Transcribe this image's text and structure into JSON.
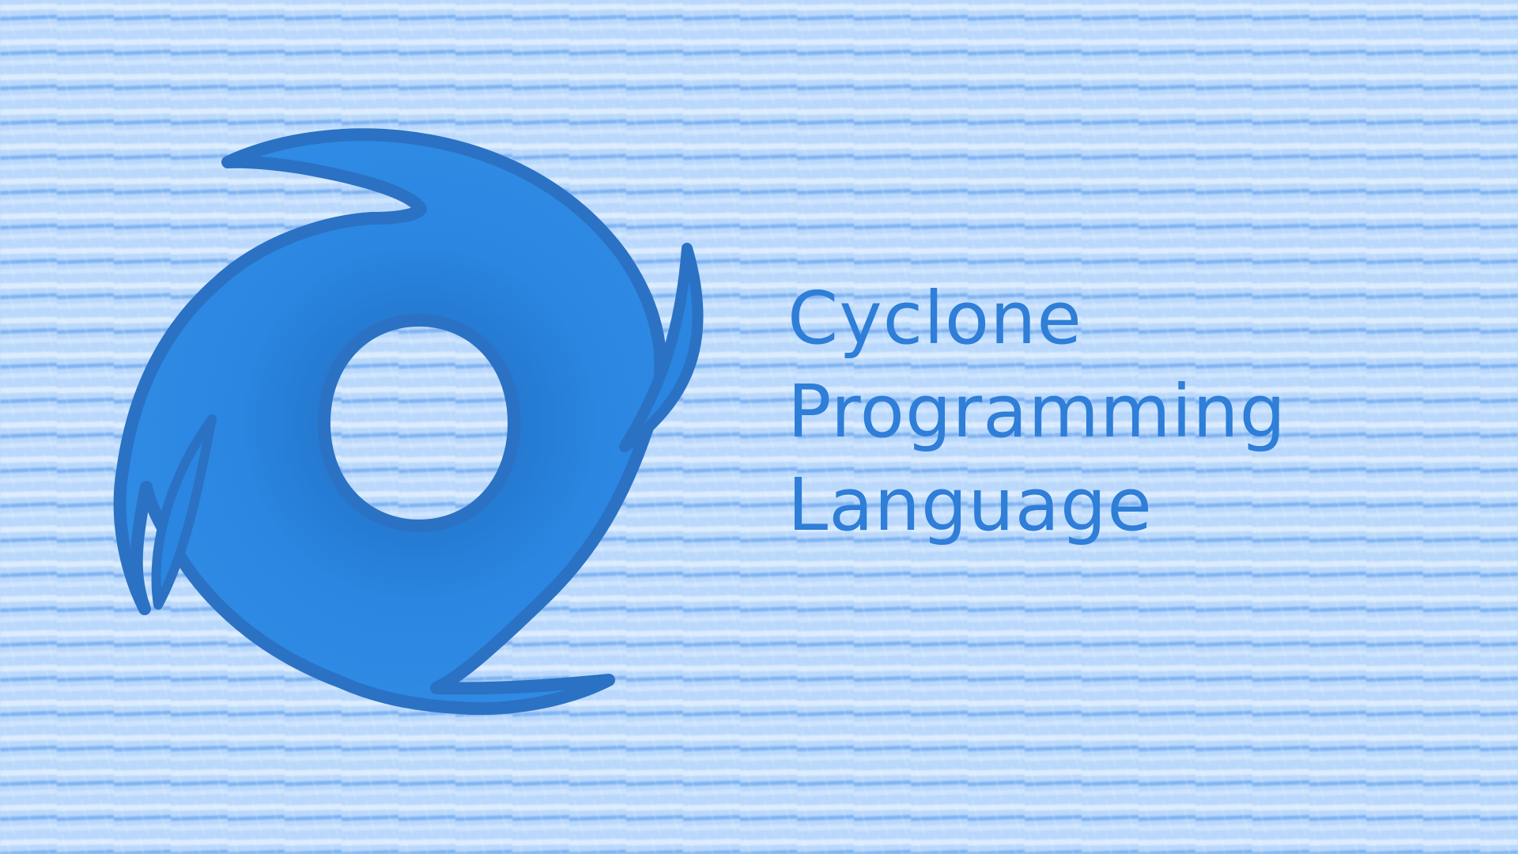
{
  "title": {
    "line1": "Cyclone",
    "line2": "Programming",
    "line3": "Language"
  },
  "logo": {
    "icon": "cyclone-icon"
  },
  "colors": {
    "background": "#b9d8fb",
    "pattern_light": "#dcecff",
    "pattern_dark": "#4f97ec",
    "logo_fill": "#2a86e0",
    "logo_stroke": "#2b72c4",
    "text": "#2f7ed8"
  }
}
